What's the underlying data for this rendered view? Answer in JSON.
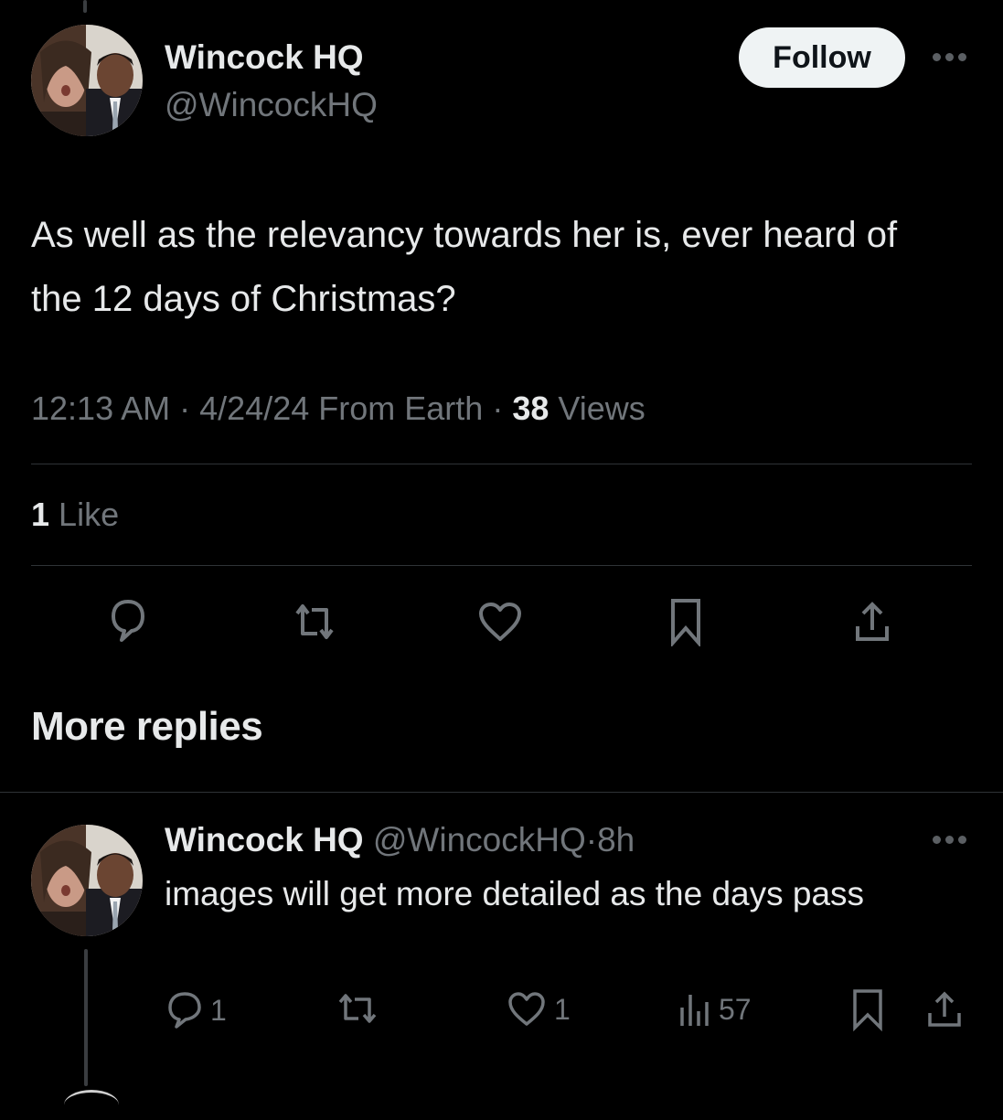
{
  "tweet": {
    "author": {
      "display_name": "Wincock HQ",
      "handle": "@WincockHQ",
      "avatar": "profile-photo"
    },
    "follow_label": "Follow",
    "more_icon": "more-dots-icon",
    "text": "As well as the relevancy towards her is, ever heard of the 12 days of Christmas?",
    "time": "12:13 AM",
    "date": "4/24/24",
    "source": "From Earth",
    "separator": "·",
    "views_count": "38",
    "views_label": "Views",
    "likes_count": "1",
    "likes_label": "Like",
    "actions": [
      {
        "name": "reply",
        "icon": "reply-bubble-icon"
      },
      {
        "name": "repost",
        "icon": "repost-icon"
      },
      {
        "name": "like",
        "icon": "heart-icon"
      },
      {
        "name": "bookmark",
        "icon": "bookmark-icon"
      },
      {
        "name": "share",
        "icon": "share-icon"
      }
    ]
  },
  "more_replies": {
    "title": "More replies"
  },
  "reply": {
    "display_name": "Wincock HQ",
    "handle": "@WincockHQ",
    "separator": "·",
    "age": "8h",
    "text": "images will get more detailed as the days pass",
    "reply_count": "1",
    "repost_count": "",
    "like_count": "1",
    "view_count": "57"
  }
}
